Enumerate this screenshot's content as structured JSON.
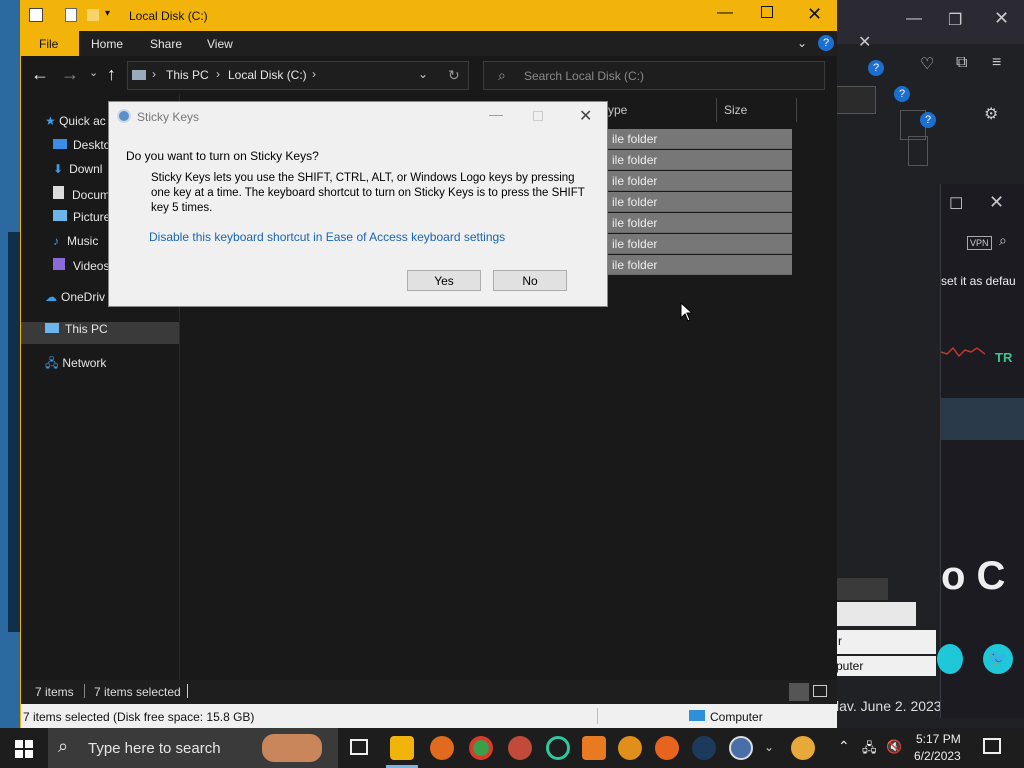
{
  "explorer": {
    "title": "Local Disk (C:)",
    "ribbon_tabs": [
      "File",
      "Home",
      "Share",
      "View"
    ],
    "breadcrumb": [
      "This PC",
      "Local Disk (C:)"
    ],
    "search_placeholder": "Search Local Disk (C:)",
    "nav_items": [
      "Quick ac",
      "Deskto",
      "Downl",
      "Docum",
      "Picture",
      "Music",
      "Videos",
      "OneDriv",
      "This PC",
      "Network"
    ],
    "columns": [
      "ype",
      "Size"
    ],
    "rows": [
      "ile folder",
      "ile folder",
      "ile folder",
      "ile folder",
      "ile folder",
      "ile folder",
      "ile folder"
    ],
    "status_items": "7 items",
    "status_selected": "7 items selected",
    "info_left": "7 items selected (Disk free space: 15.8 GB)",
    "info_right": "Computer",
    "accent": "#f2b40a"
  },
  "dialog": {
    "title": "Sticky Keys",
    "question": "Do you want to turn on Sticky Keys?",
    "body": "Sticky Keys lets you use the SHIFT, CTRL, ALT, or Windows Logo keys by pressing one key at a time. The keyboard shortcut to turn on Sticky Keys is to press the SHIFT key 5 times.",
    "link": "Disable this keyboard shortcut in Ease of Access keyboard settings",
    "yes": "Yes",
    "no": "No"
  },
  "background": {
    "browser_text": "set it as defau",
    "vpn": "VPN",
    "big_text": "o C",
    "date_text": "lav. June 2. 2023",
    "tr_text": "TR",
    "puter": "puter",
    "r": "r"
  },
  "taskbar": {
    "search_placeholder": "Type here to search",
    "time": "5:17 PM",
    "date": "6/2/2023"
  }
}
